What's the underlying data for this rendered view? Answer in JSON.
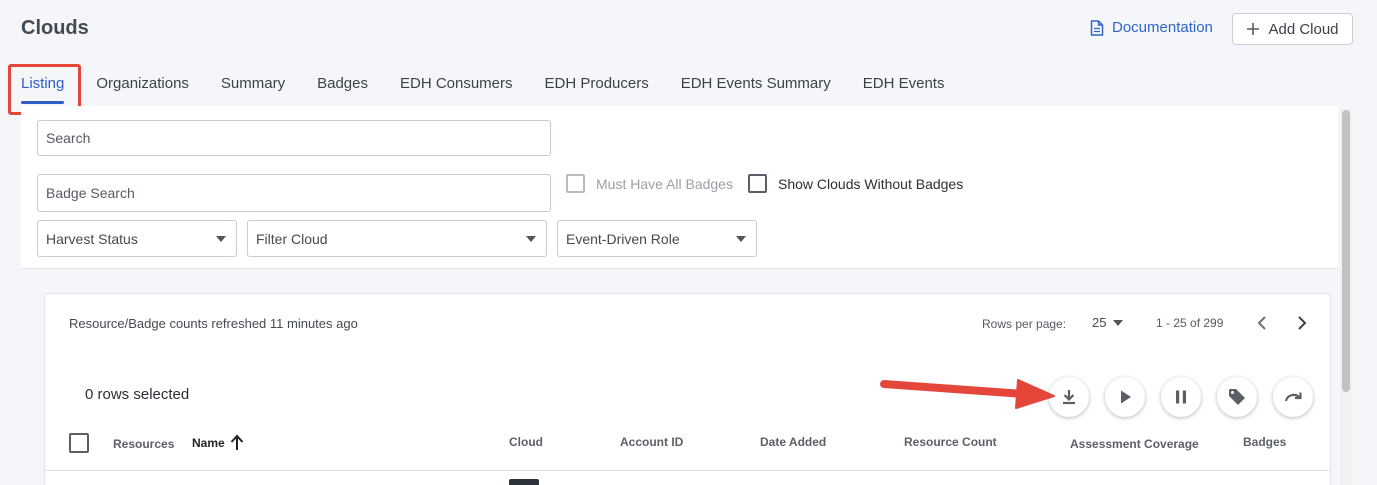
{
  "page": {
    "title": "Clouds"
  },
  "header": {
    "documentation_label": "Documentation",
    "add_cloud_label": "Add Cloud"
  },
  "tabs": [
    {
      "label": "Listing",
      "active": true
    },
    {
      "label": "Organizations"
    },
    {
      "label": "Summary"
    },
    {
      "label": "Badges"
    },
    {
      "label": "EDH Consumers"
    },
    {
      "label": "EDH Producers"
    },
    {
      "label": "EDH Events Summary"
    },
    {
      "label": "EDH Events"
    }
  ],
  "filters": {
    "search_placeholder": "Search",
    "badge_search_placeholder": "Badge Search",
    "must_have_all_badges_label": "Must Have All Badges",
    "show_without_badges_label": "Show Clouds Without Badges",
    "harvest_status_label": "Harvest Status",
    "filter_cloud_label": "Filter Cloud",
    "event_role_label": "Event-Driven Role"
  },
  "table": {
    "refresh_text": "Resource/Badge counts refreshed 11 minutes ago",
    "rows_per_page_label": "Rows per page:",
    "rows_per_page_value": "25",
    "range_text": "1 - 25 of 299",
    "rows_selected_text": "0 rows selected",
    "columns": [
      "Resources",
      "Name",
      "Cloud",
      "Account ID",
      "Date Added",
      "Resource Count",
      "Assessment Coverage",
      "Badges"
    ]
  },
  "colors": {
    "accent": "#2f5fc4",
    "annotation": "#e4463a"
  }
}
